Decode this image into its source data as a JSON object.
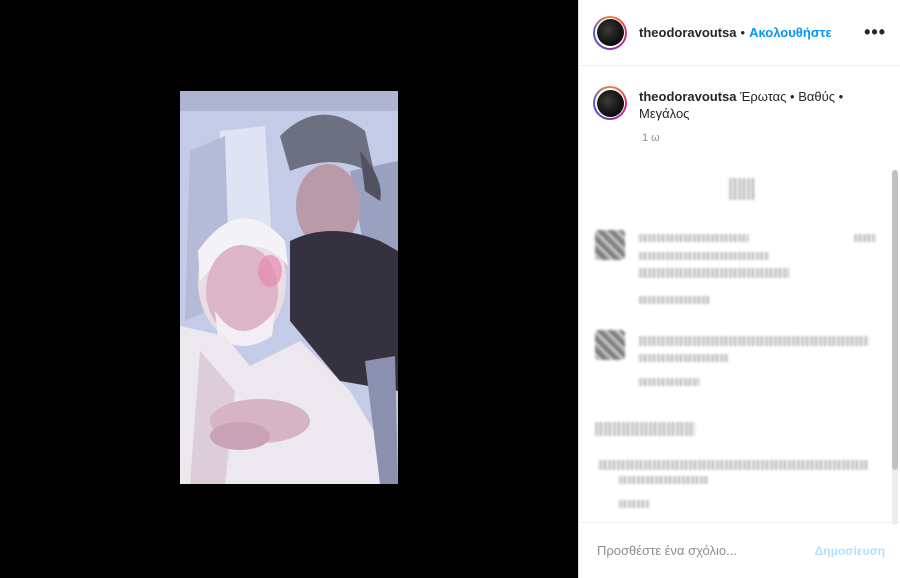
{
  "post": {
    "username": "theodoravoutsa",
    "separator": "•",
    "follow_label": "Ακολουθήστε",
    "more_icon": "•••",
    "caption_user": "theodoravoutsa",
    "caption_text": "Έρωτας • Βαθύς • Μεγάλος",
    "time": "1 ω"
  },
  "comment_box": {
    "placeholder": "Προσθέστε ένα σχόλιο...",
    "post_label": "Δημοσίευση"
  },
  "colors": {
    "accent": "#0095f6",
    "post_disabled": "#b2dffc"
  }
}
